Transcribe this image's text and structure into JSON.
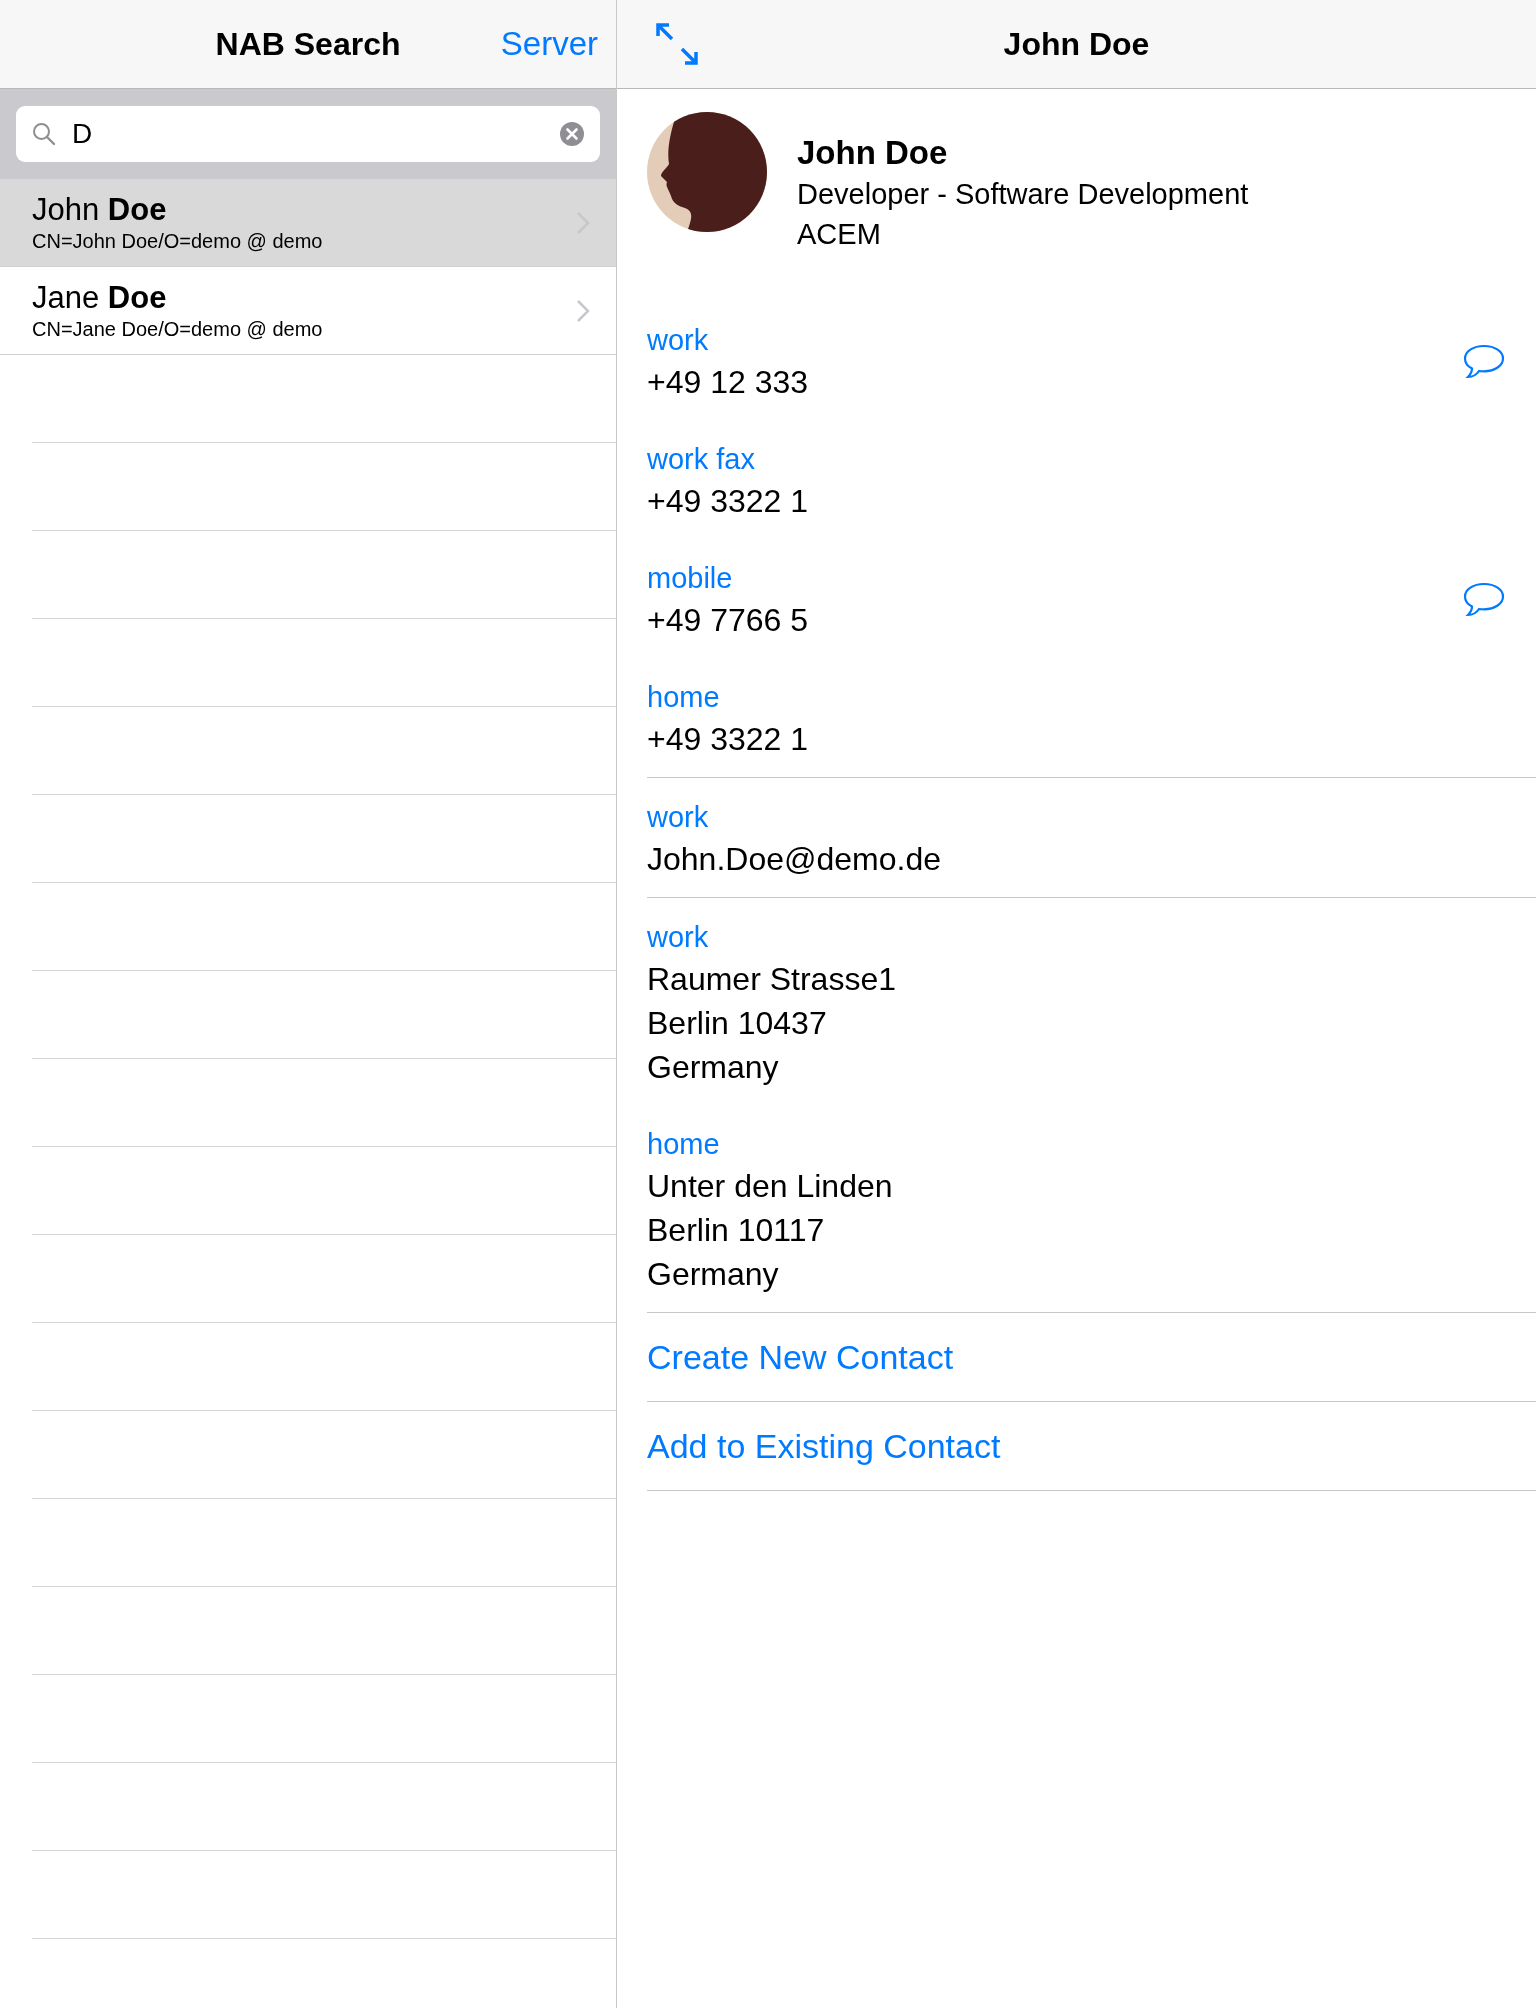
{
  "list_pane": {
    "title": "NAB Search",
    "server_button": "Server",
    "search": {
      "value": "D"
    },
    "results": [
      {
        "name": "John **Doe**",
        "dn": "CN=John Doe/O=demo @ demo",
        "selected": true
      },
      {
        "name": "Jane **Doe**",
        "dn": "CN=Jane Doe/O=demo @ demo",
        "selected": false
      }
    ]
  },
  "detail_pane": {
    "title": "John Doe",
    "contact": {
      "name": "John Doe",
      "job": "Developer - Software Development",
      "company": "ACEM"
    },
    "sections": [
      {
        "kind": "phone",
        "items": [
          {
            "label": "work",
            "lines": [
              "+49 12 333"
            ],
            "message": true
          },
          {
            "label": "work fax",
            "lines": [
              "+49 3322 1"
            ],
            "message": false
          },
          {
            "label": "mobile",
            "lines": [
              "+49 7766 5"
            ],
            "message": true
          },
          {
            "label": "home",
            "lines": [
              "+49 3322 1"
            ],
            "message": false
          }
        ]
      },
      {
        "kind": "email",
        "items": [
          {
            "label": "work",
            "lines": [
              "John.Doe@demo.de"
            ]
          }
        ]
      },
      {
        "kind": "address",
        "items": [
          {
            "label": "work",
            "lines": [
              "Raumer Strasse1",
              "Berlin 10437",
              "Germany"
            ]
          },
          {
            "label": "home",
            "lines": [
              "Unter den Linden",
              "Berlin 10117",
              "Germany"
            ]
          }
        ]
      }
    ],
    "actions": [
      "Create New Contact",
      "Add to Existing Contact"
    ]
  }
}
